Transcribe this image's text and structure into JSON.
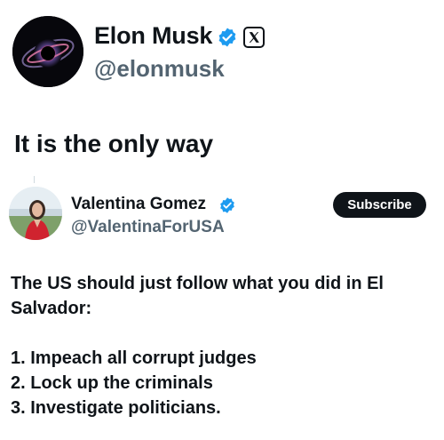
{
  "main_tweet": {
    "author_name": "Elon Musk",
    "handle": "@elonmusk",
    "text": "It is the only way"
  },
  "quoted_tweet": {
    "author_name": "Valentina Gomez",
    "handle": "@ValentinaForUSA",
    "subscribe_label": "Subscribe",
    "lines": [
      "The US should just follow what you did in El",
      "Salvador:",
      "1. Impeach all corrupt judges",
      "2. Lock up the criminals",
      "3. Investigate politicians."
    ]
  },
  "colors": {
    "verified": "#1d9bf0",
    "text_primary": "#0f1419",
    "text_secondary": "#536471",
    "button_bg": "#0f1419"
  },
  "icons": {
    "verified": "verified-badge-icon",
    "x_logo": "x-logo-icon"
  }
}
